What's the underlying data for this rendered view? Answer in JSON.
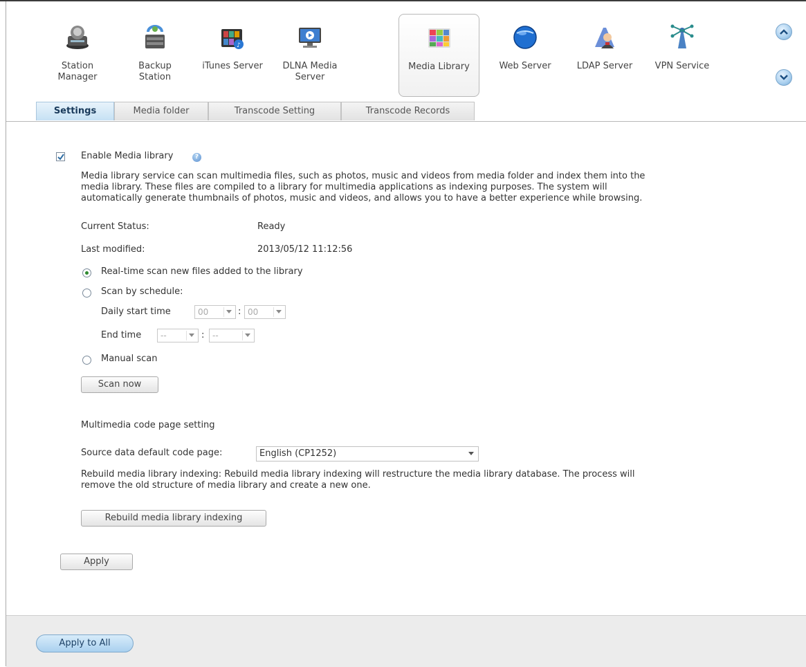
{
  "apps": [
    {
      "label": "Station\nManager",
      "icon": "station-manager-icon"
    },
    {
      "label": "Backup\nStation",
      "icon": "backup-station-icon"
    },
    {
      "label": "iTunes Server",
      "icon": "itunes-server-icon"
    },
    {
      "label": "DLNA Media\nServer",
      "icon": "dlna-media-server-icon"
    },
    {
      "label": "Media Library",
      "icon": "media-library-icon",
      "active": true
    },
    {
      "label": "Web Server",
      "icon": "web-server-icon"
    },
    {
      "label": "LDAP Server",
      "icon": "ldap-server-icon"
    },
    {
      "label": "VPN Service",
      "icon": "vpn-service-icon"
    }
  ],
  "tabs": [
    "Settings",
    "Media folder",
    "Transcode Setting",
    "Transcode Records"
  ],
  "settings": {
    "enable_label": "Enable Media library",
    "enable_checked": true,
    "description": "Media library service can scan multimedia files, such as photos, music and videos from media folder and index them into the media library. These files are compiled to a library for multimedia applications as indexing purposes. The system will automatically generate thumbnails of photos, music and videos, and allows you to have a better experience while browsing.",
    "description_lines": [
      "Media library service can scan multimedia files, such as photos, music and videos from media folder and index them into the",
      "media library. These files are compiled to a library for multimedia applications as indexing purposes. The system will",
      "automatically generate thumbnails of photos, music and videos, and allows you to have a better experience while browsing."
    ],
    "current_status_label": "Current Status:",
    "current_status_value": "Ready",
    "last_modified_label": "Last modified:",
    "last_modified_value": "2013/05/12 11:12:56",
    "scan_options": [
      {
        "label": "Real-time scan new files added to the library",
        "selected": true
      },
      {
        "label": "Scan by schedule:",
        "selected": false
      },
      {
        "label": "Manual scan",
        "selected": false
      }
    ],
    "daily_start_label": "Daily start time",
    "daily_start_hour": "00",
    "daily_start_minute": "00",
    "end_time_label": "End time",
    "end_hour": "--",
    "end_minute": "--",
    "time_separator": ":",
    "scan_now_button": "Scan now",
    "codepage_heading": "Multimedia code page setting",
    "codepage_label": "Source data default code page:",
    "codepage_value": "English (CP1252)",
    "rebuild_description_lines": [
      "Rebuild media library indexing: Rebuild media library indexing will restructure the media library database. The process will",
      "remove the old structure of media library and create a new one."
    ],
    "rebuild_button": "Rebuild media library indexing",
    "apply_button": "Apply"
  },
  "footer": {
    "apply_all_button": "Apply to All"
  },
  "colors": {
    "accent": "#a9d0ef",
    "radio_selected": "#2e8a2e",
    "active_tab": "#c6e1f4"
  }
}
